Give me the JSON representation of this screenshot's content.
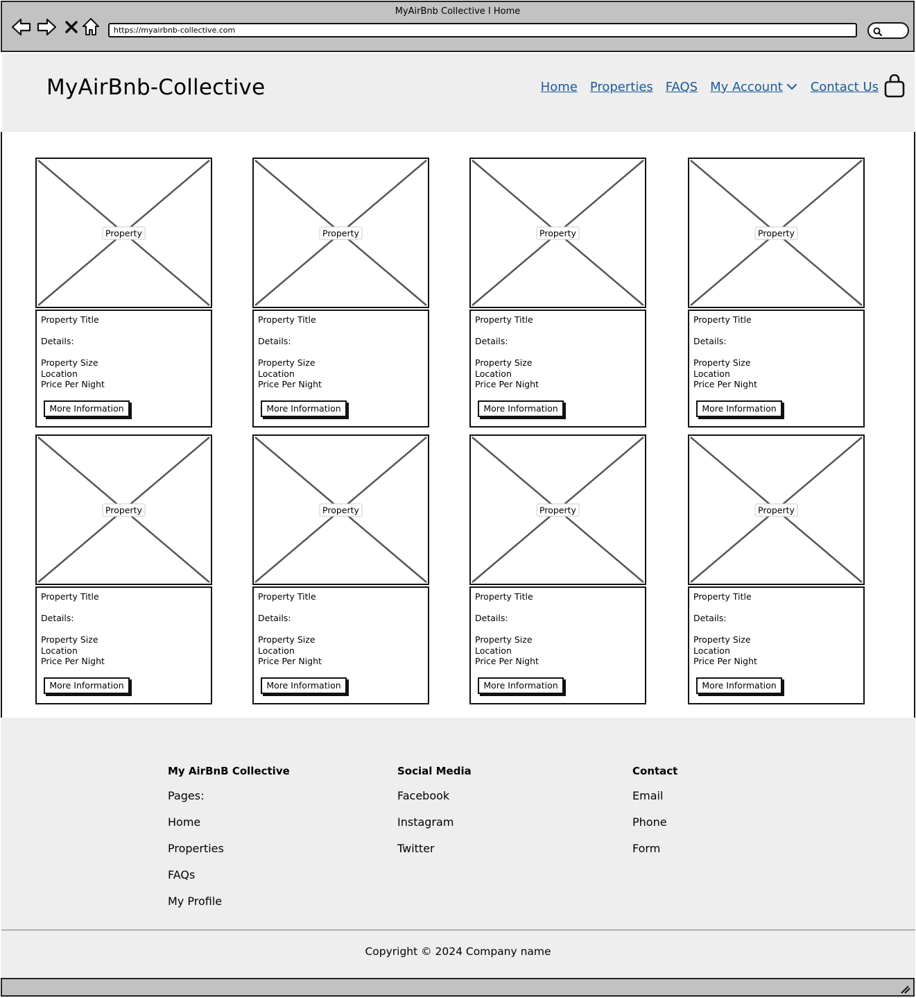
{
  "browser": {
    "window_title": "MyAirBnb Collective I Home",
    "url": "https://myairbnb-collective.com"
  },
  "header": {
    "brand": "MyAirBnb-Collective",
    "nav": [
      {
        "label": "Home"
      },
      {
        "label": "Properties"
      },
      {
        "label": "FAQS"
      },
      {
        "label": "My Account"
      },
      {
        "label": "Contact Us"
      }
    ]
  },
  "cards": [
    {
      "image_label": "Property",
      "title": "Property Title",
      "details": "Details:",
      "size": "Property Size",
      "location": "Location",
      "price": "Price Per Night",
      "button": "More Information"
    },
    {
      "image_label": "Property",
      "title": "Property Title",
      "details": "Details:",
      "size": "Property Size",
      "location": "Location",
      "price": "Price Per Night",
      "button": "More Information"
    },
    {
      "image_label": "Property",
      "title": "Property Title",
      "details": "Details:",
      "size": "Property Size",
      "location": "Location",
      "price": "Price Per Night",
      "button": "More Information"
    },
    {
      "image_label": "Property",
      "title": "Property Title",
      "details": "Details:",
      "size": "Property Size",
      "location": "Location",
      "price": "Price Per Night",
      "button": "More Information"
    },
    {
      "image_label": "Property",
      "title": "Property Title",
      "details": "Details:",
      "size": "Property Size",
      "location": "Location",
      "price": "Price Per Night",
      "button": "More Information"
    },
    {
      "image_label": "Property",
      "title": "Property Title",
      "details": "Details:",
      "size": "Property Size",
      "location": "Location",
      "price": "Price Per Night",
      "button": "More Information"
    },
    {
      "image_label": "Property",
      "title": "Property Title",
      "details": "Details:",
      "size": "Property Size",
      "location": "Location",
      "price": "Price Per Night",
      "button": "More Information"
    },
    {
      "image_label": "Property",
      "title": "Property Title",
      "details": "Details:",
      "size": "Property Size",
      "location": "Location",
      "price": "Price Per Night",
      "button": "More Information"
    }
  ],
  "footer": {
    "columns": [
      {
        "heading": "My AirBnB Collective",
        "items": [
          "Pages:",
          "Home",
          "Properties",
          "FAQs",
          "My Profile"
        ]
      },
      {
        "heading": "Social Media",
        "items": [
          "Facebook",
          "Instagram",
          "Twitter"
        ]
      },
      {
        "heading": "Contact",
        "items": [
          "Email",
          "Phone",
          "Form"
        ]
      }
    ],
    "copyright": "Copyright © 2024 Company name"
  }
}
